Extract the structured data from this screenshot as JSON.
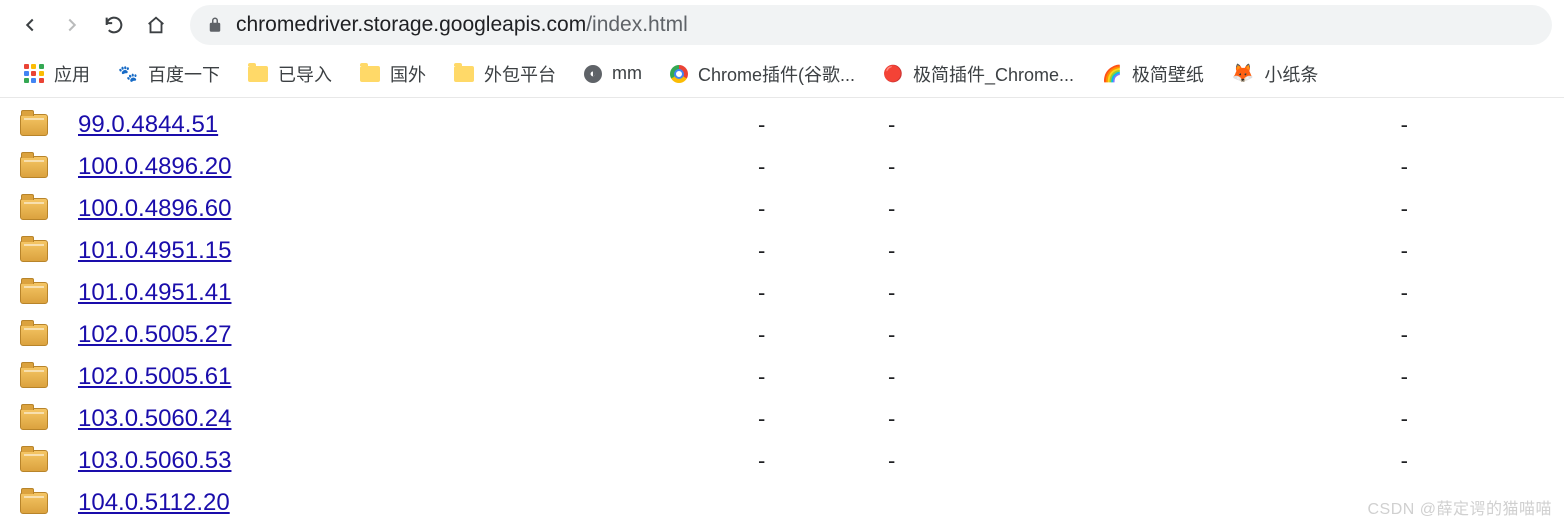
{
  "browser": {
    "url_domain": "chromedriver.storage.googleapis.com",
    "url_path": "/index.html"
  },
  "bookmarks": {
    "apps": "应用",
    "baidu": "百度一下",
    "imported": "已导入",
    "foreign": "国外",
    "outsource": "外包平台",
    "mm": "mm",
    "chrome_plugin": "Chrome插件(谷歌...",
    "simple_plugin": "极简插件_Chrome...",
    "wallpaper": "极简壁纸",
    "note": "小纸条"
  },
  "listing": [
    {
      "name": "99.0.4844.51",
      "c1": "-",
      "c2": "-",
      "c3": "-"
    },
    {
      "name": "100.0.4896.20",
      "c1": "-",
      "c2": "-",
      "c3": "-"
    },
    {
      "name": "100.0.4896.60",
      "c1": "-",
      "c2": "-",
      "c3": "-"
    },
    {
      "name": "101.0.4951.15",
      "c1": "-",
      "c2": "-",
      "c3": "-"
    },
    {
      "name": "101.0.4951.41",
      "c1": "-",
      "c2": "-",
      "c3": "-"
    },
    {
      "name": "102.0.5005.27",
      "c1": "-",
      "c2": "-",
      "c3": "-"
    },
    {
      "name": "102.0.5005.61",
      "c1": "-",
      "c2": "-",
      "c3": "-"
    },
    {
      "name": "103.0.5060.24",
      "c1": "-",
      "c2": "-",
      "c3": "-"
    },
    {
      "name": "103.0.5060.53",
      "c1": "-",
      "c2": "-",
      "c3": "-"
    },
    {
      "name": "104.0.5112.20",
      "c1": "",
      "c2": "",
      "c3": ""
    }
  ],
  "watermark": "CSDN @薛定谔的猫喵喵"
}
